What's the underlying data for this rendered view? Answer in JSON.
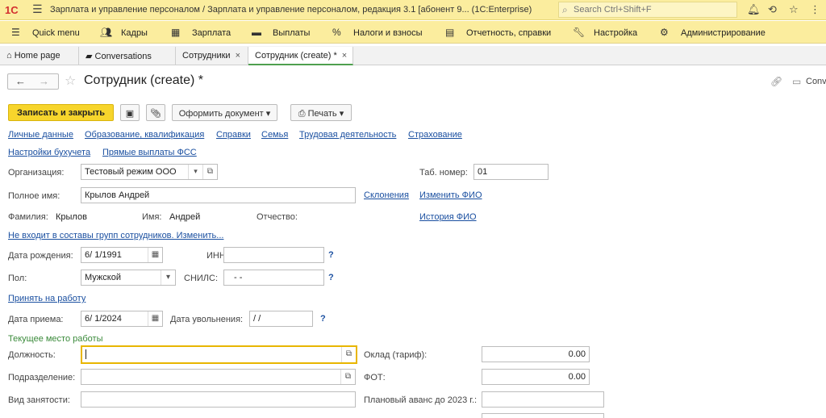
{
  "titlebar": {
    "logo": "1С",
    "title": "Зарплата и управление персоналом / Зарплата и управление персоналом, редакция 3.1 [абонент 9...   (1C:Enterprise)",
    "search_placeholder": "Search Ctrl+Shift+F"
  },
  "menu": {
    "items": [
      {
        "label": "Quick menu",
        "icon": "menu-icon"
      },
      {
        "label": "Кадры",
        "icon": "people-icon"
      },
      {
        "label": "Зарплата",
        "icon": "calculator-icon"
      },
      {
        "label": "Выплаты",
        "icon": "wallet-icon"
      },
      {
        "label": "Налоги и взносы",
        "icon": "percent-icon"
      },
      {
        "label": "Отчетность, справки",
        "icon": "reports-icon"
      },
      {
        "label": "Настройка",
        "icon": "wrench-icon"
      },
      {
        "label": "Администрирование",
        "icon": "gear-icon"
      }
    ]
  },
  "tabs": [
    {
      "label": "Home page"
    },
    {
      "label": "Conversations"
    },
    {
      "label": "Сотрудники"
    },
    {
      "label": "Сотрудник (create) *"
    }
  ],
  "form": {
    "title": "Сотрудник (create) *",
    "conversations_label": "Conv",
    "toolbar": {
      "save_close": "Записать и закрыть",
      "issue_document": "Оформить документ",
      "print": "Печать"
    },
    "links_row1": [
      "Личные данные",
      "Образование, квалификация",
      "Справки",
      "Семья",
      "Трудовая деятельность",
      "Страхование"
    ],
    "links_row2": [
      "Настройки бухучета",
      "Прямые выплаты ФСС"
    ],
    "org_label": "Организация:",
    "org_value": "Тестовый режим ООО",
    "tab_num_label": "Таб. номер:",
    "tab_num_value": "01",
    "fullname_label": "Полное имя:",
    "fullname_value": "Крылов Андрей",
    "declension_link": "Склонения",
    "change_fio_link": "Изменить ФИО",
    "surname_label": "Фамилия:",
    "surname_value": "Крылов",
    "name_label": "Имя:",
    "name_value": "Андрей",
    "patronymic_label": "Отчество:",
    "fio_history_link": "История ФИО",
    "groups_link": "Не входит в составы групп сотрудников. Изменить...",
    "birth_label": "Дата рождения:",
    "birth_value": "6/ 1/1991",
    "inn_label": "ИНН:",
    "gender_label": "Пол:",
    "gender_value": "Мужской",
    "snils_label": "СНИЛС:",
    "snils_value": "-   -",
    "hire_link": "Принять на работу",
    "hire_date_label": "Дата приема:",
    "hire_date_value": "6/ 1/2024",
    "dismiss_date_label": "Дата увольнения:",
    "dismiss_date_value": " /  /",
    "section_current_job": "Текущее место работы",
    "position_label": "Должность:",
    "salary_label": "Оклад (тариф):",
    "salary_value": "0.00",
    "department_label": "Подразделение:",
    "fot_label": "ФОТ:",
    "fot_value": "0.00",
    "employment_label": "Вид занятости:",
    "advance_label": "Плановый аванс до 2023 г.:",
    "question_mark": "?"
  }
}
